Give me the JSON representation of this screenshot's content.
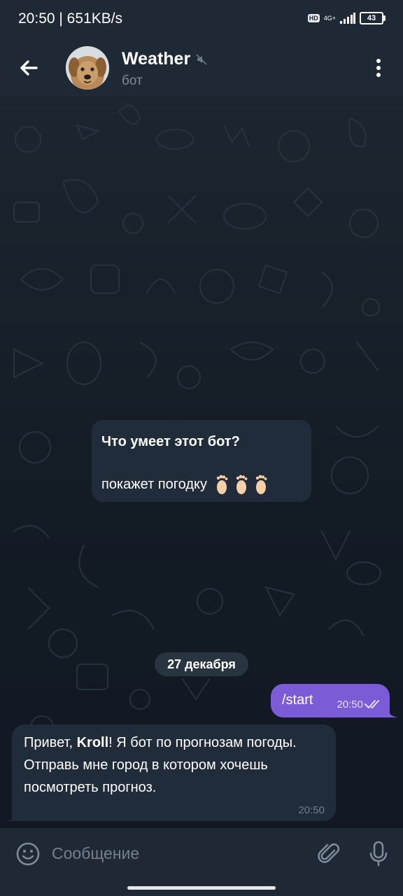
{
  "status_bar": {
    "time": "20:50 | 651KB/s",
    "hd_label": "HD",
    "network_label": "4G+",
    "battery": "43"
  },
  "header": {
    "title": "Weather",
    "subtitle": "бот",
    "back_icon": "arrow-left-icon",
    "muted_icon": "speaker-muted-icon",
    "menu_icon": "more-vertical-icon"
  },
  "intro_card": {
    "title": "Что умеет этот бот?",
    "body": "покажет погодку",
    "emoji": [
      "🦶🏻",
      "🦶🏻",
      "🦶🏻"
    ]
  },
  "date_chip": "27 декабря",
  "messages": [
    {
      "direction": "out",
      "text": "/start",
      "time": "20:50",
      "read": true
    },
    {
      "direction": "in",
      "line1_prefix": "Привет, ",
      "line1_name": "Kroll",
      "line1_suffix": "! Я бот по прогнозам погоды.",
      "line2": "Отправь мне город в котором хочешь посмотреть прогноз.",
      "time": "20:50"
    }
  ],
  "input": {
    "placeholder": "Сообщение",
    "value": ""
  },
  "colors": {
    "header_bg": "#1f2835",
    "chat_bg": "#121a23",
    "incoming_bubble": "#212c3a",
    "outgoing_bubble": "#7c5cd6",
    "muted_text": "#7d8b99"
  }
}
